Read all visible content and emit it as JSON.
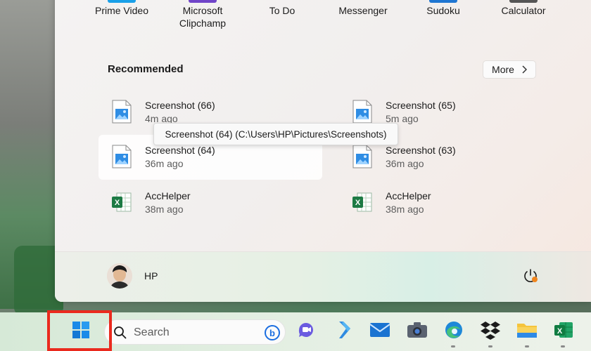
{
  "pinned_apps": [
    {
      "label": "Prime Video",
      "bar_color": "#1aa0e8"
    },
    {
      "label": "Microsoft Clipchamp",
      "bar_color": "#7045c8"
    },
    {
      "label": "To Do",
      "bar_color": ""
    },
    {
      "label": "Messenger",
      "bar_color": ""
    },
    {
      "label": "Sudoku",
      "bar_color": "#1f76d2"
    },
    {
      "label": "Calculator",
      "bar_color": "#555555"
    }
  ],
  "recommended": {
    "title": "Recommended",
    "more_label": "More",
    "items": [
      {
        "name": "Screenshot (66)",
        "time": "4m ago",
        "icon": "image-file-icon"
      },
      {
        "name": "Screenshot (65)",
        "time": "5m ago",
        "icon": "image-file-icon"
      },
      {
        "name": "Screenshot (64)",
        "time": "36m ago",
        "icon": "image-file-icon"
      },
      {
        "name": "Screenshot (63)",
        "time": "36m ago",
        "icon": "image-file-icon"
      },
      {
        "name": "AccHelper",
        "time": "38m ago",
        "icon": "excel-file-icon"
      },
      {
        "name": "AccHelper",
        "time": "38m ago",
        "icon": "excel-file-icon"
      }
    ],
    "tooltip": "Screenshot (64) (C:\\Users\\HP\\Pictures\\Screenshots)"
  },
  "user": {
    "name": "HP"
  },
  "taskbar": {
    "search_label": "Search",
    "apps": [
      "windows-start-icon",
      "bing-icon",
      "teams-chat-icon",
      "visual-studio-icon",
      "mail-icon",
      "camera-icon",
      "edge-icon",
      "dropbox-icon",
      "file-explorer-icon",
      "excel-icon"
    ]
  },
  "colors": {
    "highlight_box": "#ea2a1e",
    "accent": "#0067c0"
  }
}
